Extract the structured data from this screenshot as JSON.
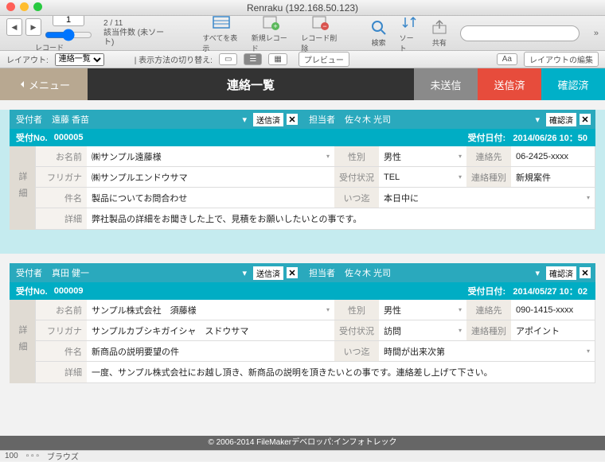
{
  "window": {
    "title": "Renraku (192.168.50.123)"
  },
  "toolbar": {
    "record_current": "1",
    "record_pos": "2 / 11",
    "record_status": "該当件数 (未ソート)",
    "record_label": "レコード",
    "showall": "すべてを表示",
    "newrec": "新規レコード",
    "delrec": "レコード削除",
    "search": "検索",
    "sort": "ソート",
    "share": "共有",
    "search_placeholder": ""
  },
  "layout": {
    "label": "レイアウト:",
    "selected": "連絡一覧",
    "switch_label": "表示方法の切り替え:",
    "preview": "プレビュー",
    "edit": "レイアウトの編集"
  },
  "tabs": {
    "menu": "メニュー",
    "title": "連絡一覧",
    "misou": "未送信",
    "sou": "送信済",
    "kaku": "確認済"
  },
  "records": [
    {
      "receiver_label": "受付者",
      "receiver": "遠藤 香苗",
      "status": "送信済",
      "tantou_label": "担当者",
      "tantou": "佐々木 光司",
      "right_status": "確認済",
      "no_label": "受付No.",
      "no": "000005",
      "date_label": "受付日付:",
      "date": "2014/06/26  10：50",
      "sidelabel": "詳細",
      "rows": {
        "namae_l": "お名前",
        "namae": "㈱サンプル遠藤様",
        "seibetsu_l": "性別",
        "seibetsu": "男性",
        "renrakusaki_l": "連絡先",
        "renrakusaki": "06-2425-xxxx",
        "furigana_l": "フリガナ",
        "furigana": "㈱サンプルエンドウサマ",
        "jyoukyou_l": "受付状況",
        "jyoukyou": "TEL",
        "shubetsu_l": "連絡種別",
        "shubetsu": "新規案件",
        "kenmei_l": "件名",
        "kenmei": "製品についてお問合わせ",
        "itsu_l": "いつ迄",
        "itsu": "本日中に",
        "shousai_l": "詳細",
        "shousai": "弊社製品の詳細をお聞きした上で、見積をお願いしたいとの事です。"
      }
    },
    {
      "receiver_label": "受付者",
      "receiver": "真田 健一",
      "status": "送信済",
      "tantou_label": "担当者",
      "tantou": "佐々木 光司",
      "right_status": "確認済",
      "no_label": "受付No.",
      "no": "000009",
      "date_label": "受付日付:",
      "date": "2014/05/27  10：02",
      "sidelabel": "詳細",
      "rows": {
        "namae_l": "お名前",
        "namae": "サンプル株式会社　須藤様",
        "seibetsu_l": "性別",
        "seibetsu": "男性",
        "renrakusaki_l": "連絡先",
        "renrakusaki": "090-1415-xxxx",
        "furigana_l": "フリガナ",
        "furigana": "サンプルカブシキガイシャ　スドウサマ",
        "jyoukyou_l": "受付状況",
        "jyoukyou": "訪問",
        "shubetsu_l": "連絡種別",
        "shubetsu": "アポイント",
        "kenmei_l": "件名",
        "kenmei": "新商品の説明要望の件",
        "itsu_l": "いつ迄",
        "itsu": "時間が出来次第",
        "shousai_l": "詳細",
        "shousai": "一度、サンプル株式会社にお越し頂き、新商品の説明を頂きたいとの事です。連絡差し上げて下さい。"
      }
    }
  ],
  "footer": "© 2006-2014 FileMakerデベロッパ:インフォトレック",
  "status": {
    "zoom": "100",
    "mode": "ブラウズ"
  }
}
